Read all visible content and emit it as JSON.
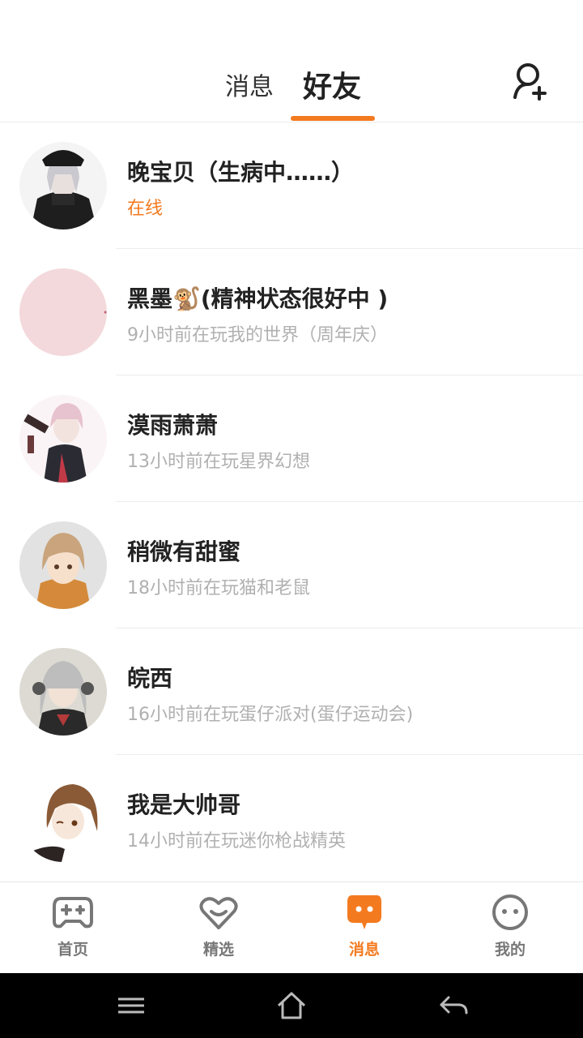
{
  "header": {
    "tabs": [
      "消息",
      "好友"
    ],
    "active_tab": "好友"
  },
  "friends": [
    {
      "name": "晚宝贝（生病中……）",
      "status": "在线",
      "online": true
    },
    {
      "name": "黑墨🐒(精神状态很好中 )",
      "status": "9小时前在玩我的世界（周年庆）",
      "online": false
    },
    {
      "name": "漠雨萧萧",
      "status": "13小时前在玩星界幻想",
      "online": false
    },
    {
      "name": "稍微有甜蜜",
      "status": "18小时前在玩猫和老鼠",
      "online": false
    },
    {
      "name": "皖西",
      "status": "16小时前在玩蛋仔派对(蛋仔运动会)",
      "online": false
    },
    {
      "name": "我是大帅哥",
      "status": "14小时前在玩迷你枪战精英",
      "online": false
    }
  ],
  "bottom_nav": [
    {
      "label": "首页",
      "icon": "gamepad-icon"
    },
    {
      "label": "精选",
      "icon": "heart-icon"
    },
    {
      "label": "消息",
      "icon": "chat-bubble-icon",
      "active": true
    },
    {
      "label": "我的",
      "icon": "face-icon"
    }
  ],
  "colors": {
    "accent": "#f47a20",
    "muted": "#b0b0b0",
    "text": "#222222"
  }
}
